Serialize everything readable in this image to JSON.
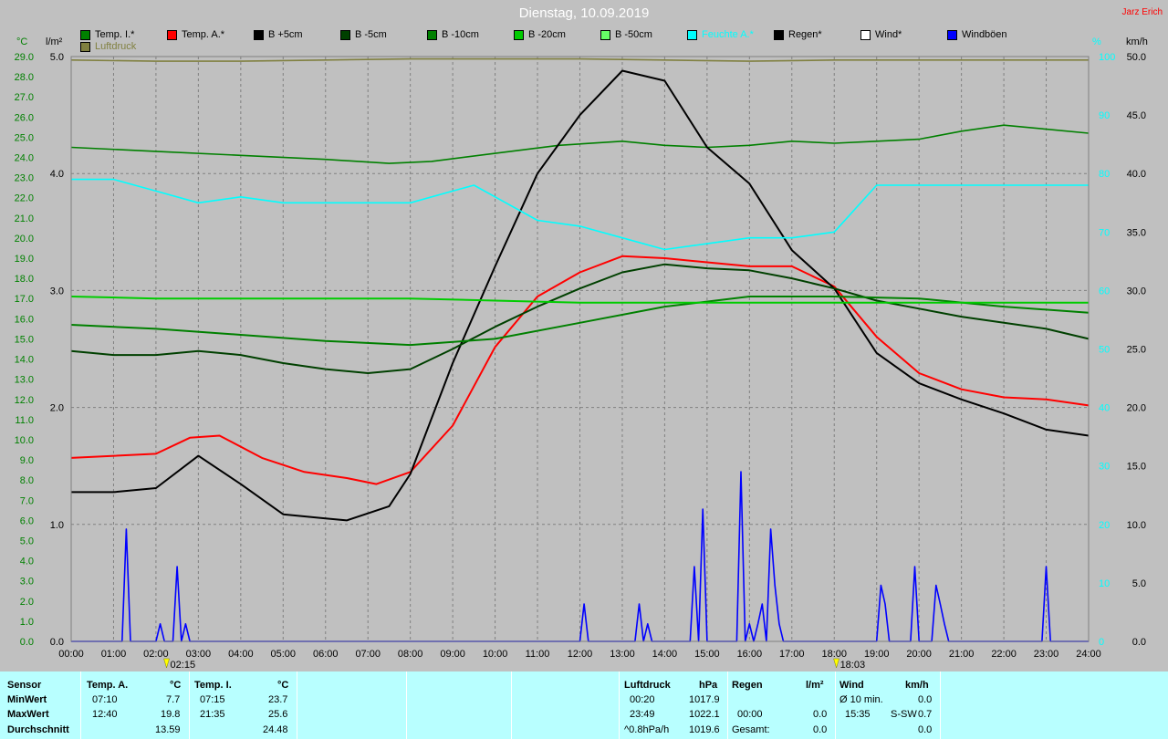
{
  "title": "Dienstag, 10.09.2019",
  "author": "Jarz Erich",
  "units": {
    "left1": "°C",
    "left2": "l/m²",
    "right1": "%",
    "right2": "km/h"
  },
  "legend": [
    {
      "label": "Temp. I.*",
      "color": "#008000"
    },
    {
      "label": "Temp. A.*",
      "color": "#ff0000"
    },
    {
      "label": "B +5cm",
      "color": "#000000"
    },
    {
      "label": "B -5cm",
      "color": "#004000"
    },
    {
      "label": "B -10cm",
      "color": "#008000"
    },
    {
      "label": "B -20cm",
      "color": "#00cc00"
    },
    {
      "label": "B -50cm",
      "color": "#66ff66"
    },
    {
      "label": "Feuchte A.*",
      "color": "#00ffff"
    },
    {
      "label": "Regen*",
      "color": "#000000"
    },
    {
      "label": "Wind*",
      "color": "#ffffff"
    },
    {
      "label": "Windböen",
      "color": "#0000ff"
    },
    {
      "label": "Luftdruck",
      "color": "#808040"
    }
  ],
  "chart_data": {
    "type": "line",
    "x_ticks": [
      "00:00",
      "01:00",
      "02:00",
      "03:00",
      "04:00",
      "05:00",
      "06:00",
      "07:00",
      "08:00",
      "09:00",
      "10:00",
      "11:00",
      "12:00",
      "13:00",
      "14:00",
      "15:00",
      "16:00",
      "17:00",
      "18:00",
      "19:00",
      "20:00",
      "21:00",
      "22:00",
      "23:00",
      "24:00"
    ],
    "xlim": [
      0,
      24
    ],
    "y_temp_ticks": [
      "0.0",
      "1.0",
      "2.0",
      "3.0",
      "4.0",
      "5.0",
      "6.0",
      "7.0",
      "8.0",
      "9.0",
      "10.0",
      "11.0",
      "12.0",
      "13.0",
      "14.0",
      "15.0",
      "16.0",
      "17.0",
      "18.0",
      "19.0",
      "20.0",
      "21.0",
      "22.0",
      "23.0",
      "24.0",
      "25.0",
      "26.0",
      "27.0",
      "28.0",
      "29.0"
    ],
    "ylim_temp": [
      0,
      29
    ],
    "y_rain_ticks": [
      "0.0",
      "1.0",
      "2.0",
      "3.0",
      "4.0",
      "5.0"
    ],
    "ylim_rain": [
      0,
      5
    ],
    "y_hum_ticks": [
      "0",
      "10",
      "20",
      "30",
      "40",
      "50",
      "60",
      "70",
      "80",
      "90",
      "100"
    ],
    "ylim_hum": [
      0,
      100
    ],
    "y_wind_ticks": [
      "0.0",
      "5.0",
      "10.0",
      "15.0",
      "20.0",
      "25.0",
      "30.0",
      "35.0",
      "40.0",
      "45.0",
      "50.0"
    ],
    "ylim_wind": [
      0,
      50
    ],
    "markers": [
      {
        "label": "02:15",
        "x": 2.25
      },
      {
        "label": "18:03",
        "x": 18.05
      }
    ],
    "series": [
      {
        "name": "Temp. I.*",
        "axis": "temp",
        "color": "#008000",
        "points": [
          [
            0,
            24.5
          ],
          [
            2,
            24.3
          ],
          [
            4,
            24.1
          ],
          [
            6,
            23.9
          ],
          [
            7.5,
            23.7
          ],
          [
            8.5,
            23.8
          ],
          [
            10,
            24.2
          ],
          [
            11.5,
            24.6
          ],
          [
            13,
            24.8
          ],
          [
            14,
            24.6
          ],
          [
            15,
            24.5
          ],
          [
            16,
            24.6
          ],
          [
            17,
            24.8
          ],
          [
            18,
            24.7
          ],
          [
            19,
            24.8
          ],
          [
            20,
            24.9
          ],
          [
            21,
            25.3
          ],
          [
            22,
            25.6
          ],
          [
            23,
            25.4
          ],
          [
            24,
            25.2
          ]
        ]
      },
      {
        "name": "Temp. A.*",
        "axis": "temp",
        "color": "#ff0000",
        "points": [
          [
            0,
            9.1
          ],
          [
            2,
            9.3
          ],
          [
            2.8,
            10.1
          ],
          [
            3.5,
            10.2
          ],
          [
            4.5,
            9.1
          ],
          [
            5.5,
            8.4
          ],
          [
            6.5,
            8.1
          ],
          [
            7.2,
            7.8
          ],
          [
            8,
            8.4
          ],
          [
            9,
            10.7
          ],
          [
            10,
            14.6
          ],
          [
            11,
            17.1
          ],
          [
            12,
            18.3
          ],
          [
            13,
            19.1
          ],
          [
            14,
            19.0
          ],
          [
            15,
            18.8
          ],
          [
            16,
            18.6
          ],
          [
            17,
            18.6
          ],
          [
            18,
            17.6
          ],
          [
            19,
            15.1
          ],
          [
            20,
            13.3
          ],
          [
            21,
            12.5
          ],
          [
            22,
            12.1
          ],
          [
            23,
            12.0
          ],
          [
            24,
            11.7
          ]
        ]
      },
      {
        "name": "B +5cm",
        "axis": "temp",
        "color": "#000000",
        "points": [
          [
            0,
            7.4
          ],
          [
            1,
            7.4
          ],
          [
            2,
            7.6
          ],
          [
            3,
            9.2
          ],
          [
            4,
            7.8
          ],
          [
            5,
            6.3
          ],
          [
            6,
            6.1
          ],
          [
            6.5,
            6.0
          ],
          [
            7.5,
            6.7
          ],
          [
            8,
            8.3
          ],
          [
            9,
            13.8
          ],
          [
            10,
            18.6
          ],
          [
            11,
            23.2
          ],
          [
            12,
            26.1
          ],
          [
            13,
            28.3
          ],
          [
            14,
            27.8
          ],
          [
            15,
            24.5
          ],
          [
            16,
            22.7
          ],
          [
            17,
            19.4
          ],
          [
            18,
            17.5
          ],
          [
            19,
            14.3
          ],
          [
            20,
            12.8
          ],
          [
            21,
            12.0
          ],
          [
            22,
            11.3
          ],
          [
            23,
            10.5
          ],
          [
            24,
            10.2
          ]
        ]
      },
      {
        "name": "B -5cm",
        "axis": "temp",
        "color": "#004000",
        "points": [
          [
            0,
            14.4
          ],
          [
            1,
            14.2
          ],
          [
            2,
            14.2
          ],
          [
            3,
            14.4
          ],
          [
            4,
            14.2
          ],
          [
            5,
            13.8
          ],
          [
            6,
            13.5
          ],
          [
            7,
            13.3
          ],
          [
            8,
            13.5
          ],
          [
            9,
            14.5
          ],
          [
            10,
            15.6
          ],
          [
            11,
            16.6
          ],
          [
            12,
            17.5
          ],
          [
            13,
            18.3
          ],
          [
            14,
            18.7
          ],
          [
            15,
            18.5
          ],
          [
            16,
            18.4
          ],
          [
            17,
            18.0
          ],
          [
            18,
            17.5
          ],
          [
            19,
            16.9
          ],
          [
            20,
            16.5
          ],
          [
            21,
            16.1
          ],
          [
            22,
            15.8
          ],
          [
            23,
            15.5
          ],
          [
            24,
            15.0
          ]
        ]
      },
      {
        "name": "B -10cm",
        "axis": "temp",
        "color": "#008000",
        "points": [
          [
            0,
            15.7
          ],
          [
            2,
            15.5
          ],
          [
            4,
            15.2
          ],
          [
            6,
            14.9
          ],
          [
            8,
            14.7
          ],
          [
            10,
            15.0
          ],
          [
            12,
            15.8
          ],
          [
            14,
            16.6
          ],
          [
            16,
            17.1
          ],
          [
            18,
            17.1
          ],
          [
            20,
            17.0
          ],
          [
            22,
            16.6
          ],
          [
            24,
            16.3
          ]
        ]
      },
      {
        "name": "B -20cm",
        "axis": "temp",
        "color": "#00cc00",
        "points": [
          [
            0,
            17.1
          ],
          [
            2,
            17.0
          ],
          [
            4,
            17.0
          ],
          [
            6,
            17.0
          ],
          [
            8,
            17.0
          ],
          [
            10,
            16.9
          ],
          [
            12,
            16.8
          ],
          [
            14,
            16.8
          ],
          [
            16,
            16.8
          ],
          [
            18,
            16.8
          ],
          [
            20,
            16.8
          ],
          [
            22,
            16.8
          ],
          [
            24,
            16.8
          ]
        ]
      },
      {
        "name": "Feuchte A.*",
        "axis": "hum",
        "color": "#00ffff",
        "points": [
          [
            0,
            79
          ],
          [
            1,
            79
          ],
          [
            2,
            77
          ],
          [
            3,
            75
          ],
          [
            4,
            76
          ],
          [
            5,
            75
          ],
          [
            6,
            75
          ],
          [
            7,
            75
          ],
          [
            8,
            75
          ],
          [
            9,
            77
          ],
          [
            9.5,
            78
          ],
          [
            10,
            76
          ],
          [
            11,
            72
          ],
          [
            12,
            71
          ],
          [
            13,
            69
          ],
          [
            14,
            67
          ],
          [
            15,
            68
          ],
          [
            16,
            69
          ],
          [
            17,
            69
          ],
          [
            18,
            70
          ],
          [
            19,
            78
          ],
          [
            20,
            78
          ],
          [
            21,
            78
          ],
          [
            22,
            78
          ],
          [
            23,
            78
          ],
          [
            24,
            78
          ]
        ]
      },
      {
        "name": "Luftdruck",
        "axis": "rain",
        "color": "#808040",
        "points": [
          [
            0,
            4.97
          ],
          [
            2,
            4.96
          ],
          [
            4,
            4.96
          ],
          [
            6,
            4.97
          ],
          [
            8,
            4.98
          ],
          [
            10,
            4.98
          ],
          [
            12,
            4.98
          ],
          [
            14,
            4.97
          ],
          [
            16,
            4.96
          ],
          [
            18,
            4.97
          ],
          [
            20,
            4.97
          ],
          [
            22,
            4.97
          ],
          [
            24,
            4.97
          ]
        ]
      },
      {
        "name": "Windböen",
        "axis": "wind",
        "color": "#0000ff",
        "points": [
          [
            0,
            0
          ],
          [
            1.2,
            0
          ],
          [
            1.3,
            9.6
          ],
          [
            1.4,
            0
          ],
          [
            2,
            0
          ],
          [
            2.1,
            1.5
          ],
          [
            2.2,
            0
          ],
          [
            2.4,
            0
          ],
          [
            2.5,
            6.4
          ],
          [
            2.6,
            0
          ],
          [
            2.7,
            1.5
          ],
          [
            2.8,
            0
          ],
          [
            12,
            0
          ],
          [
            12.1,
            3.2
          ],
          [
            12.2,
            0
          ],
          [
            13.3,
            0
          ],
          [
            13.4,
            3.2
          ],
          [
            13.5,
            0
          ],
          [
            13.6,
            1.5
          ],
          [
            13.7,
            0
          ],
          [
            14.6,
            0
          ],
          [
            14.7,
            6.4
          ],
          [
            14.8,
            0
          ],
          [
            14.9,
            11.3
          ],
          [
            15.0,
            0
          ],
          [
            15.7,
            0
          ],
          [
            15.8,
            14.5
          ],
          [
            15.9,
            0
          ],
          [
            16.0,
            1.5
          ],
          [
            16.1,
            0
          ],
          [
            16.2,
            1.5
          ],
          [
            16.3,
            3.2
          ],
          [
            16.4,
            0
          ],
          [
            16.5,
            9.6
          ],
          [
            16.6,
            4.8
          ],
          [
            16.7,
            1.5
          ],
          [
            16.8,
            0
          ],
          [
            19.0,
            0
          ],
          [
            19.1,
            4.8
          ],
          [
            19.2,
            3.2
          ],
          [
            19.3,
            0
          ],
          [
            19.8,
            0
          ],
          [
            19.9,
            6.4
          ],
          [
            20.0,
            0
          ],
          [
            20.3,
            0
          ],
          [
            20.4,
            4.8
          ],
          [
            20.5,
            3.2
          ],
          [
            20.6,
            1.5
          ],
          [
            20.7,
            0
          ],
          [
            22.9,
            0
          ],
          [
            23.0,
            6.4
          ],
          [
            23.1,
            0
          ],
          [
            24,
            0
          ]
        ]
      }
    ]
  },
  "table": {
    "sensor_header": "Sensor",
    "rows": [
      "MinWert",
      "MaxWert",
      "Durchschnitt"
    ],
    "temp_a": {
      "header": "Temp. A.",
      "unit": "°C",
      "min_time": "07:10",
      "min_val": "7.7",
      "max_time": "12:40",
      "max_val": "19.8",
      "avg": "13.59"
    },
    "temp_i": {
      "header": "Temp. I.",
      "unit": "°C",
      "min_time": "07:15",
      "min_val": "23.7",
      "max_time": "21:35",
      "max_val": "25.6",
      "avg": "24.48"
    },
    "pressure": {
      "header": "Luftdruck",
      "unit": "hPa",
      "min_time": "00:20",
      "min_val": "1017.9",
      "max_time": "23:49",
      "max_val": "1022.1",
      "avg_label": "^0.8hPa/h",
      "avg": "1019.6"
    },
    "rain": {
      "header": "Regen",
      "unit": "l/m²",
      "max_time": "00:00",
      "max_val": "0.0",
      "total_label": "Gesamt:",
      "total_val": "0.0"
    },
    "wind": {
      "header": "Wind",
      "unit": "km/h",
      "row1_label": "Ø 10 min.",
      "row1_val": "0.0",
      "row2_time": "15:35",
      "row2_dir": "S-SW",
      "row2_val": "0.7",
      "row3_val": "0.0"
    }
  }
}
